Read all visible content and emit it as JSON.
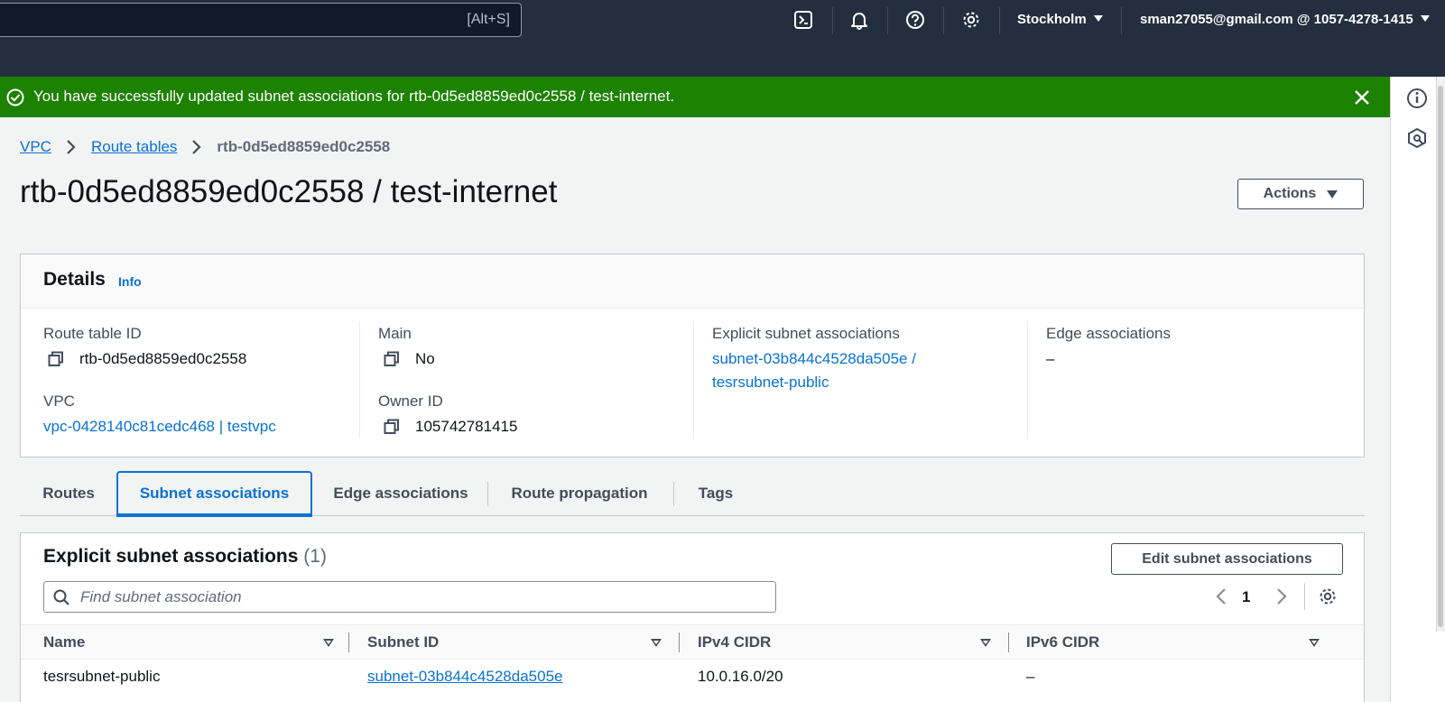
{
  "topnav": {
    "search_shortcut": "[Alt+S]",
    "region": "Stockholm",
    "account": "sman27055@gmail.com @ 1057-4278-1415"
  },
  "flash": {
    "message": "You have successfully updated subnet associations for rtb-0d5ed8859ed0c2558 / test-internet."
  },
  "breadcrumb": [
    "VPC",
    "Route tables",
    "rtb-0d5ed8859ed0c2558"
  ],
  "page": {
    "title": "rtb-0d5ed8859ed0c2558 / test-internet",
    "actions_label": "Actions"
  },
  "details": {
    "title": "Details",
    "info_label": "Info",
    "route_table_id_label": "Route table ID",
    "route_table_id": "rtb-0d5ed8859ed0c2558",
    "main_label": "Main",
    "main": "No",
    "explicit_label": "Explicit subnet associations",
    "explicit_line1": "subnet-03b844c4528da505e /",
    "explicit_line2": "tesrsubnet-public",
    "edge_label": "Edge associations",
    "edge": "–",
    "vpc_label": "VPC",
    "vpc": "vpc-0428140c81cedc468 | testvpc",
    "owner_label": "Owner ID",
    "owner": "105742781415"
  },
  "tabs": [
    "Routes",
    "Subnet associations",
    "Edge associations",
    "Route propagation",
    "Tags"
  ],
  "active_tab": "Subnet associations",
  "explicit_table": {
    "title": "Explicit subnet associations",
    "count": "(1)",
    "edit_label": "Edit subnet associations",
    "search_placeholder": "Find subnet association",
    "page": "1",
    "columns": [
      "Name",
      "Subnet ID",
      "IPv4 CIDR",
      "IPv6 CIDR"
    ],
    "rows": [
      {
        "name": "tesrsubnet-public",
        "subnet_id": "subnet-03b844c4528da505e",
        "ipv4": "10.0.16.0/20",
        "ipv6": "–"
      }
    ]
  },
  "colors": {
    "nav_bg": "#232f3e",
    "success": "#1d8102",
    "link": "#0972d3"
  },
  "icons": [
    "cloudshell-icon",
    "bell-icon",
    "help-icon",
    "settings-gear-icon",
    "check-circle-icon",
    "close-icon",
    "info-icon",
    "hexagon-icon",
    "copy-icon",
    "search-icon",
    "chevron-left-icon",
    "chevron-right-icon"
  ]
}
